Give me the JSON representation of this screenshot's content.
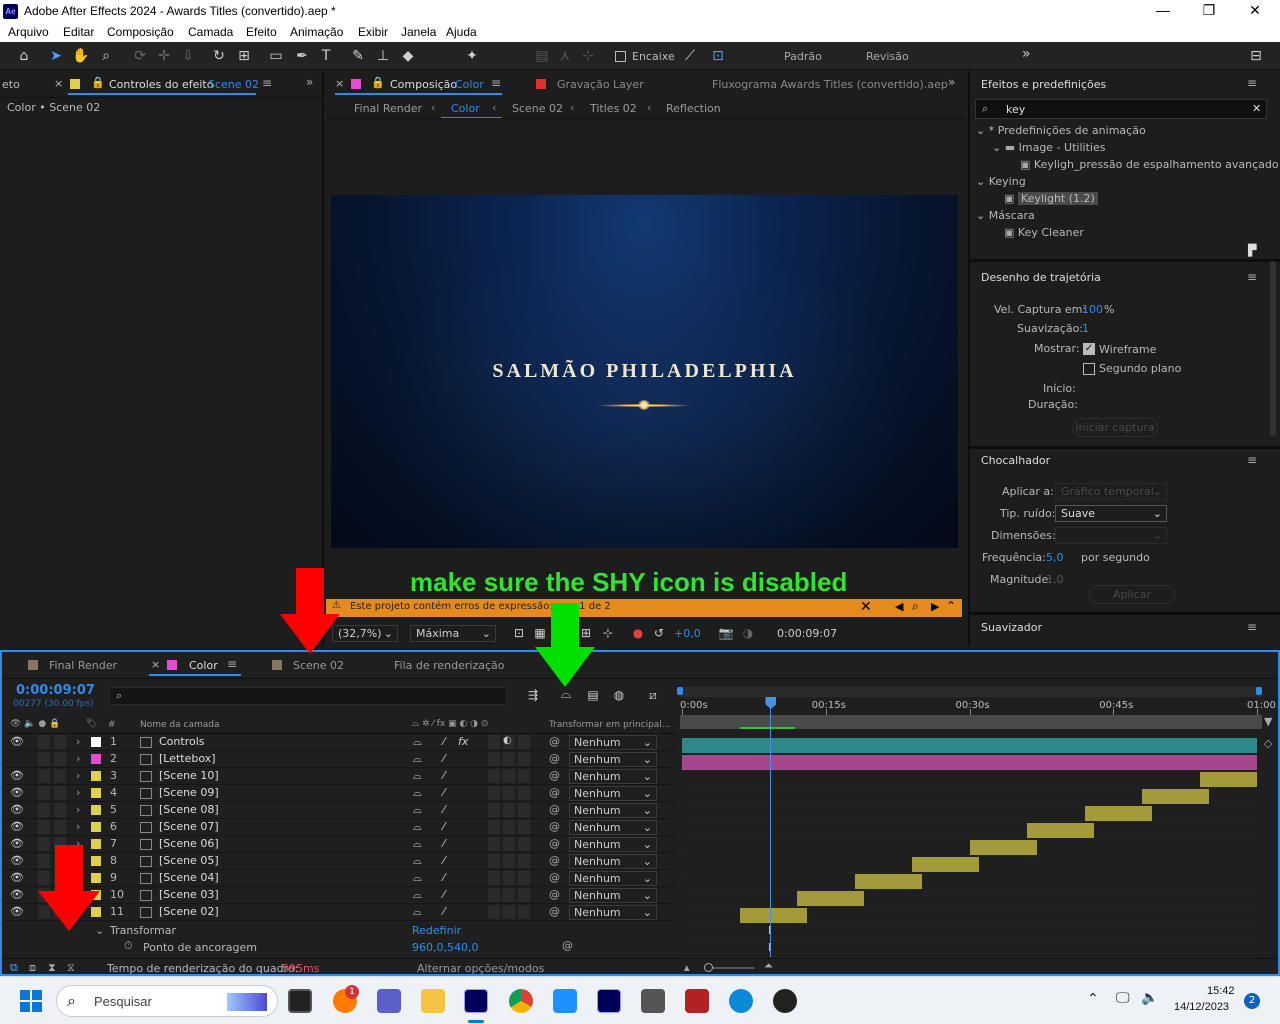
{
  "window": {
    "app_icon": "Ae",
    "title": "Adobe After Effects 2024 - Awards Titles (convertido).aep *",
    "minimize": "—",
    "maximize": "❐",
    "close": "✕"
  },
  "menu": [
    "Arquivo",
    "Editar",
    "Composição",
    "Camada",
    "Efeito",
    "Animação",
    "Exibir",
    "Janela",
    "Ajuda"
  ],
  "toolbar": {
    "snap_label": "Encaixe",
    "workspace_default": "Padrão",
    "workspace_review": "Revisão",
    "more": "»"
  },
  "effect_controls": {
    "left_cut_tab": "eto",
    "tab_label": "Controles do efeito",
    "tab_target": "Scene 02",
    "path": "Color • Scene 02"
  },
  "composition": {
    "tab_label": "Composição",
    "tab_name": "Color",
    "tab2": "Gravação  Layer",
    "flowchart": "Fluxograma Awards Titles (convertido).aep",
    "breadcrumbs": [
      "Final Render",
      "Color",
      "Scene 02",
      "Titles 02",
      "Reflection"
    ],
    "active_breadcrumb": "Color",
    "preview_title": "SALMÃO PHILADELPHIA",
    "error_text": "Este projeto contém erros de expressão: erro 1 de 2",
    "zoom": "(32,7%)",
    "resolution": "Máxima",
    "exposure": "+0,0",
    "timecode": "0:00:09:07"
  },
  "annotation": {
    "text": "make sure the SHY icon is disabled"
  },
  "effects_presets": {
    "title": "Efeitos e predefinições",
    "search_value": "key",
    "tree": [
      {
        "label": "* Predefinições de animação",
        "level": 0,
        "icon": "chevron"
      },
      {
        "label": "Image - Utilities",
        "level": 1,
        "icon": "folder"
      },
      {
        "label": "Keyligh_pressão de espalhamento avançado",
        "level": 2,
        "icon": "preset"
      },
      {
        "label": "Keying",
        "level": 0,
        "icon": "chevron"
      },
      {
        "label": "Keylight (1.2)",
        "level": 1,
        "icon": "effect",
        "selected": true
      },
      {
        "label": "Máscara",
        "level": 0,
        "icon": "chevron"
      },
      {
        "label": "Key Cleaner",
        "level": 1,
        "icon": "effect"
      }
    ]
  },
  "motion_sketch": {
    "title": "Desenho de trajetória",
    "capture_speed_label": "Vel. Captura em:",
    "capture_speed_value": "100",
    "capture_speed_unit": "%",
    "smoothing_label": "Suavização:",
    "smoothing_value": "1",
    "show_label": "Mostrar:",
    "wireframe_label": "Wireframe",
    "wireframe_checked": true,
    "background_label": "Segundo plano",
    "background_checked": false,
    "start_label": "Início:",
    "duration_label": "Duração:",
    "start_capture": "Iniciar captura"
  },
  "wiggler": {
    "title": "Chocalhador",
    "apply_to_label": "Aplicar a:",
    "apply_to_value": "Gráfico temporal",
    "noise_type_label": "Tip. ruído:",
    "noise_type_value": "Suave",
    "dimensions_label": "Dimensões:",
    "frequency_label": "Frequência:",
    "frequency_value": "5,0",
    "frequency_unit": "por segundo",
    "magnitude_label": "Magnitude:",
    "magnitude_value": "1,0",
    "apply_button": "Aplicar"
  },
  "smoother": {
    "title": "Suavizador"
  },
  "timeline": {
    "tabs": [
      {
        "label": "Final Render",
        "color": "#8a7560"
      },
      {
        "label": "Color",
        "color": "#e84bd0",
        "active": true
      },
      {
        "label": "Scene 02",
        "color": "#8a7560"
      },
      {
        "label": "Fila de renderização",
        "color": ""
      }
    ],
    "current_time": "0:00:09:07",
    "frame_info": "00277 (30.00 fps)",
    "col_layer_name": "Nome da camada",
    "col_hash": "#",
    "col_parent": "Transformar em principal...",
    "ruler": [
      "0:00s",
      "00:15s",
      "00:30s",
      "00:45s",
      "01:00"
    ],
    "playhead_seconds": 9.23,
    "duration_seconds": 60,
    "layers": [
      {
        "num": "1",
        "name": "Controls",
        "color": "#3fa6a6",
        "swatch": "#ffffff",
        "fx": true,
        "parent": "Nenhum",
        "start": 0,
        "end": 60
      },
      {
        "num": "2",
        "name": "[Lettebox]",
        "color": "#e84bd0",
        "swatch": "#e84bd0",
        "fx": false,
        "parent": "Nenhum",
        "start": 0,
        "end": 60
      },
      {
        "num": "3",
        "name": "[Scene 10]",
        "color": "#e0d050",
        "swatch": "#e0d050",
        "fx": false,
        "parent": "Nenhum",
        "start": 54,
        "end": 60
      },
      {
        "num": "4",
        "name": "[Scene 09]",
        "color": "#e0d050",
        "swatch": "#e0d050",
        "fx": false,
        "parent": "Nenhum",
        "start": 48,
        "end": 55
      },
      {
        "num": "5",
        "name": "[Scene 08]",
        "color": "#e0d050",
        "swatch": "#e0d050",
        "fx": false,
        "parent": "Nenhum",
        "start": 42,
        "end": 49
      },
      {
        "num": "6",
        "name": "[Scene 07]",
        "color": "#e0d050",
        "swatch": "#e0d050",
        "fx": false,
        "parent": "Nenhum",
        "start": 36,
        "end": 43
      },
      {
        "num": "7",
        "name": "[Scene 06]",
        "color": "#e0d050",
        "swatch": "#e0d050",
        "fx": false,
        "parent": "Nenhum",
        "start": 30,
        "end": 37
      },
      {
        "num": "8",
        "name": "[Scene 05]",
        "color": "#e0d050",
        "swatch": "#e0d050",
        "fx": false,
        "parent": "Nenhum",
        "start": 24,
        "end": 31
      },
      {
        "num": "9",
        "name": "[Scene 04]",
        "color": "#e0d050",
        "swatch": "#e0d050",
        "fx": false,
        "parent": "Nenhum",
        "start": 18,
        "end": 25
      },
      {
        "num": "10",
        "name": "[Scene 03]",
        "color": "#e0d050",
        "swatch": "#e0d050",
        "fx": false,
        "parent": "Nenhum",
        "start": 12,
        "end": 19
      },
      {
        "num": "11",
        "name": "[Scene 02]",
        "color": "#e0d050",
        "swatch": "#e0d050",
        "fx": false,
        "parent": "Nenhum",
        "start": 6,
        "end": 13
      }
    ],
    "transform_label": "Transformar",
    "transform_reset": "Redefinir",
    "anchor_label": "Ponto de ancoragem",
    "anchor_value": "960,0,540,0",
    "render_time_label": "Tempo de renderização do quadro:",
    "render_time_value": "595ms",
    "toggle_modes": "Alternar opções/modos"
  },
  "taskbar": {
    "search_placeholder": "Pesquisar",
    "time": "15:42",
    "date": "14/12/2023",
    "notification_count": "2",
    "mail_badge": "1"
  }
}
